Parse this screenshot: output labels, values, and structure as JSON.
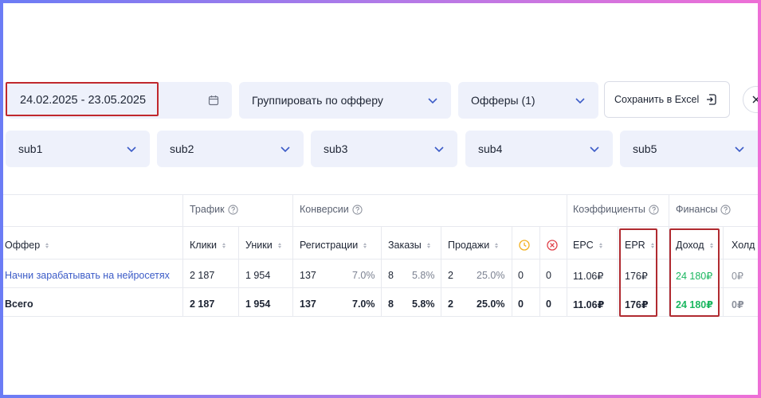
{
  "filters": {
    "date_range": "24.02.2025 - 23.05.2025",
    "group_by": "Группировать по офферу",
    "offers": "Офферы (1)",
    "excel_button": "Сохранить в Excel",
    "subs": [
      "sub1",
      "sub2",
      "sub3",
      "sub4",
      "sub5"
    ]
  },
  "table": {
    "groups": {
      "traffic": "Трафик",
      "conversions": "Конверсии",
      "coefficients": "Коэффициенты",
      "finance": "Финансы"
    },
    "columns": {
      "offer": "Оффер",
      "clicks": "Клики",
      "uniques": "Уники",
      "registrations": "Регистрации",
      "orders": "Заказы",
      "sales": "Продажи",
      "epc": "EPC",
      "epr": "EPR",
      "income": "Доход",
      "hold": "Холд"
    },
    "rows": [
      {
        "offer": "Начни зарабатывать на нейросетях",
        "clicks": "2 187",
        "uniques": "1 954",
        "registrations": "137",
        "registrations_pct": "7.0%",
        "orders": "8",
        "orders_pct": "5.8%",
        "sales": "2",
        "sales_pct": "25.0%",
        "pending": "0",
        "rejected": "0",
        "epc": "11.06₽",
        "epr": "176₽",
        "income": "24 180₽",
        "hold": "0₽"
      },
      {
        "offer": "Всего",
        "clicks": "2 187",
        "uniques": "1 954",
        "registrations": "137",
        "registrations_pct": "7.0%",
        "orders": "8",
        "orders_pct": "5.8%",
        "sales": "2",
        "sales_pct": "25.0%",
        "pending": "0",
        "rejected": "0",
        "epc": "11.06₽",
        "epr": "176₽",
        "income": "24 180₽",
        "hold": "0₽"
      }
    ]
  },
  "colors": {
    "accent_link": "#3b5bc7",
    "income_green": "#1bb760",
    "highlight_red": "#c0282d",
    "pending_icon": "#f2b01e",
    "rejected_icon": "#e0424a"
  }
}
